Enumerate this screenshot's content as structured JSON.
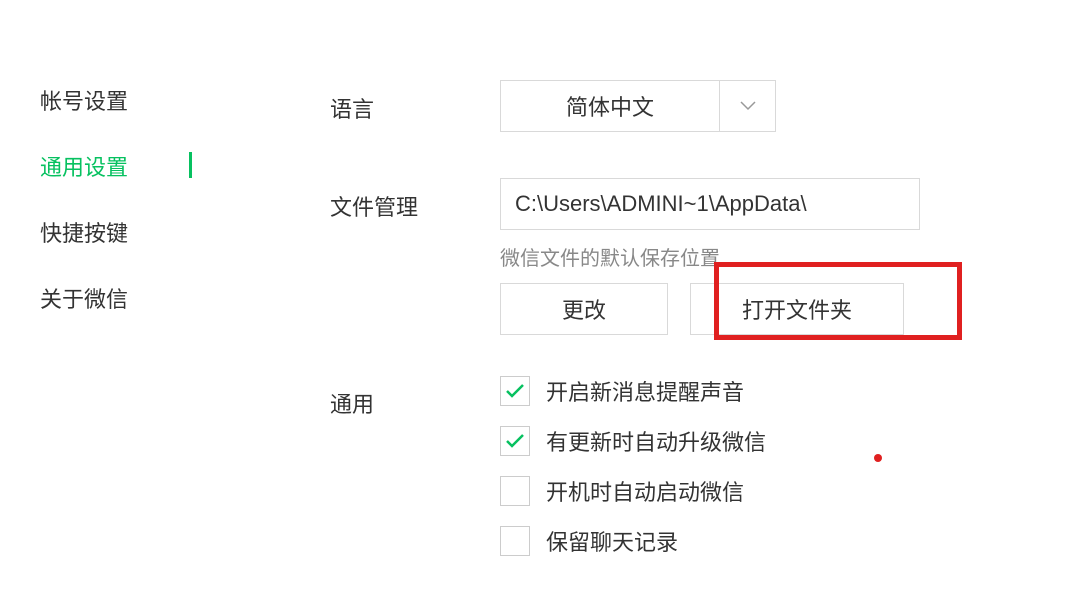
{
  "sidebar": {
    "items": [
      {
        "label": "帐号设置"
      },
      {
        "label": "通用设置"
      },
      {
        "label": "快捷按键"
      },
      {
        "label": "关于微信"
      }
    ],
    "active_index": 1
  },
  "language": {
    "label": "语言",
    "value": "简体中文"
  },
  "file_management": {
    "label": "文件管理",
    "path": "C:\\Users\\ADMINI~1\\AppData\\",
    "hint": "微信文件的默认保存位置",
    "change_button": "更改",
    "open_button": "打开文件夹"
  },
  "general": {
    "label": "通用",
    "options": [
      {
        "label": "开启新消息提醒声音",
        "checked": true
      },
      {
        "label": "有更新时自动升级微信",
        "checked": true
      },
      {
        "label": "开机时自动启动微信",
        "checked": false
      },
      {
        "label": "保留聊天记录",
        "checked": false
      }
    ]
  }
}
